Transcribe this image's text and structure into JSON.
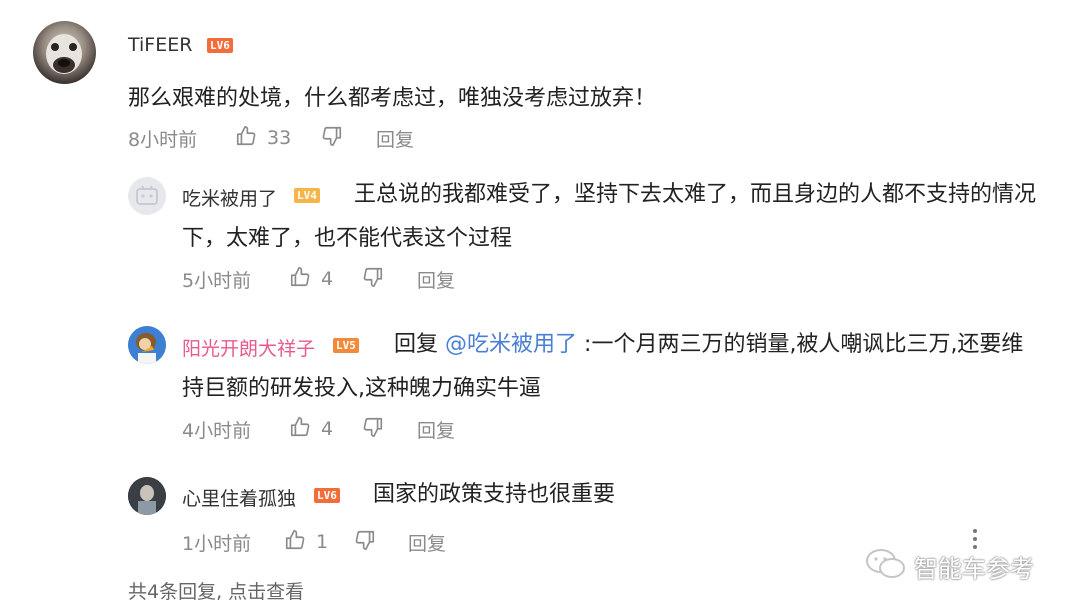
{
  "colors": {
    "lv6": "#f26d3a",
    "lv4": "#f5b54b",
    "lv5": "#f28a3a",
    "link": "#4a7fd6",
    "vip_name": "#e85a8c",
    "meta": "#8a8a8a"
  },
  "comment": {
    "username": "TiFEER",
    "level": "LV6",
    "text": "那么艰难的处境，什么都考虑过，唯独没考虑过放弃！",
    "time": "8小时前",
    "likes": "33",
    "reply_label": "回复"
  },
  "replies": [
    {
      "username": "吃米被用了",
      "level": "LV4",
      "text": "王总说的我都难受了，坚持下去太难了，而且身边的人都不支持的情况下，太难了，也不能代表这个过程",
      "time": "5小时前",
      "likes": "4",
      "reply_label": "回复"
    },
    {
      "username": "阳光开朗大祥子",
      "level": "LV5",
      "reply_prefix": "回复",
      "reply_to": "@吃米被用了",
      "text": ":一个月两三万的销量,被人嘲讽比三万,还要维持巨额的研发投入,这种魄力确实牛逼",
      "time": "4小时前",
      "likes": "4",
      "reply_label": "回复"
    },
    {
      "username": "心里住着孤独",
      "level": "LV6",
      "text": "国家的政策支持也很重要",
      "time": "1小时前",
      "likes": "1",
      "reply_label": "回复"
    }
  ],
  "footer": {
    "more_replies": "共4条回复, 点击查看"
  },
  "watermark": {
    "text": "智能车参考"
  }
}
